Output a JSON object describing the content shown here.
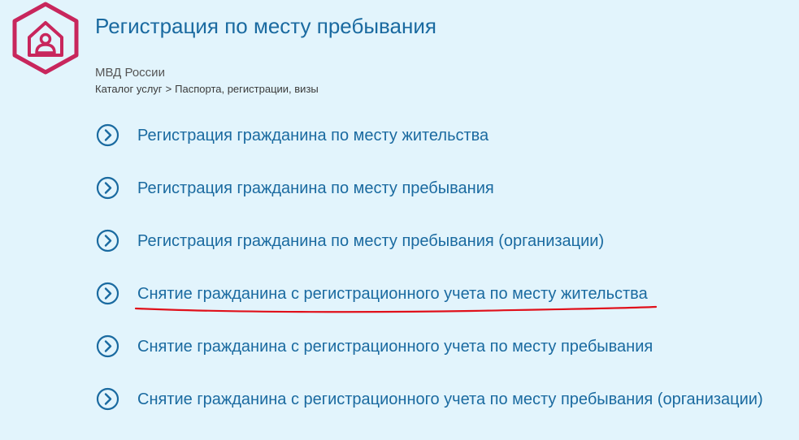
{
  "header": {
    "title": "Регистрация по месту пребывания",
    "agency": "МВД России",
    "logo_icon": "house-person-icon",
    "logo_color": "#c8265c"
  },
  "breadcrumb": {
    "catalog": "Каталог услуг",
    "separator": ">",
    "section": "Паспорта, регистрации, визы"
  },
  "services": [
    {
      "label": "Регистрация гражданина по месту жительства",
      "icon": "chevron-right-circle-icon"
    },
    {
      "label": "Регистрация гражданина по месту пребывания",
      "icon": "chevron-right-circle-icon"
    },
    {
      "label": "Регистрация гражданина по месту пребывания (организации)",
      "icon": "chevron-right-circle-icon"
    },
    {
      "label": "Снятие гражданина с регистрационного учета по месту жительства",
      "icon": "chevron-right-circle-icon",
      "underlined_in_red": true
    },
    {
      "label": "Снятие гражданина с регистрационного учета по месту пребывания",
      "icon": "chevron-right-circle-icon"
    },
    {
      "label": "Снятие гражданина с регистрационного учета по месту пребывания (организации)",
      "icon": "chevron-right-circle-icon"
    }
  ],
  "colors": {
    "background": "#e2f4fc",
    "link": "#1a6aa0",
    "annotation": "#e0101a"
  }
}
